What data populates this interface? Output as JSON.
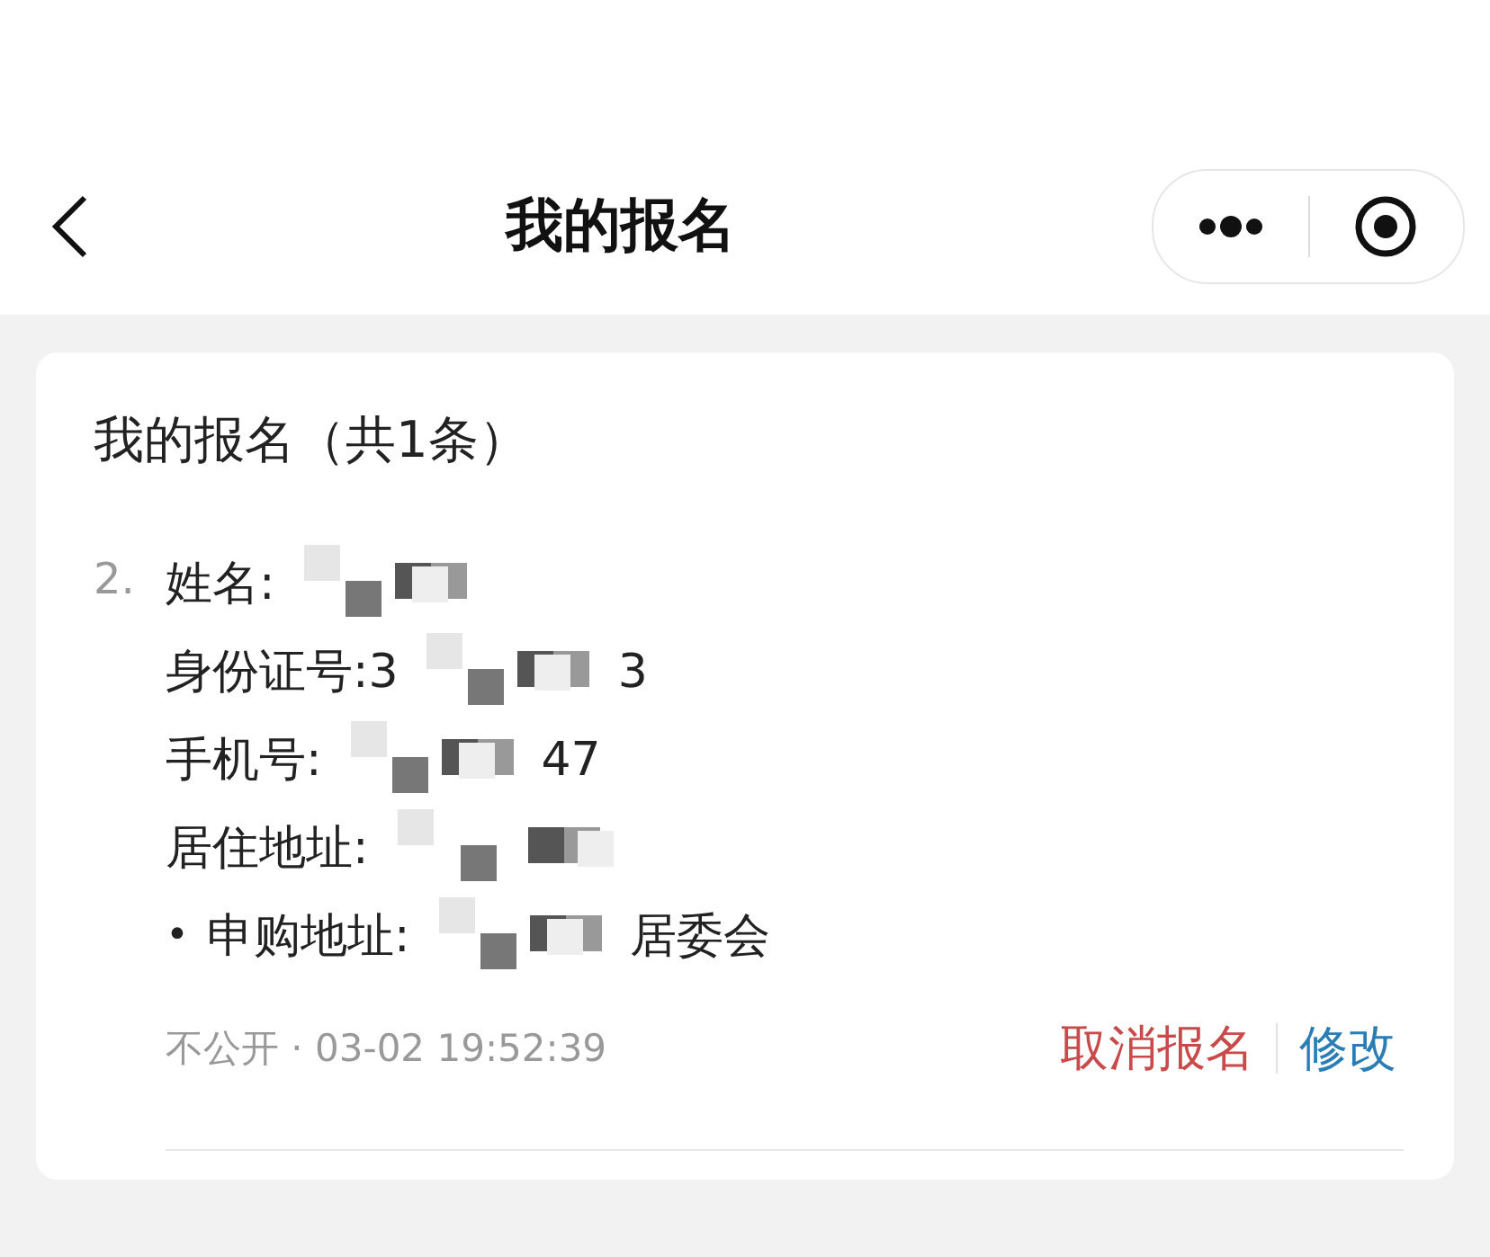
{
  "nav": {
    "title": "我的报名"
  },
  "card": {
    "title": "我的报名（共1条）",
    "entry": {
      "number": "2.",
      "fields": [
        {
          "kind": "plain",
          "label": "姓名:",
          "segments": [
            {
              "kind": "mask"
            }
          ]
        },
        {
          "kind": "plain",
          "label": "身份证号:",
          "segments": [
            {
              "kind": "text",
              "text": "3"
            },
            {
              "kind": "mask"
            },
            {
              "kind": "text",
              "text": "3"
            }
          ]
        },
        {
          "kind": "plain",
          "label": "手机号:",
          "segments": [
            {
              "kind": "mask"
            },
            {
              "kind": "text",
              "text": "47"
            }
          ]
        },
        {
          "kind": "plain",
          "label": "居住地址:",
          "segments": [
            {
              "kind": "mask"
            }
          ]
        },
        {
          "kind": "bullet",
          "bullet": "•",
          "label": "申购地址:",
          "segments": [
            {
              "kind": "mask"
            },
            {
              "kind": "text",
              "text": "居委会"
            }
          ]
        }
      ],
      "meta": "不公开 · 03-02 19:52:39",
      "actions": [
        {
          "kind": "danger",
          "label": "取消报名"
        },
        {
          "kind": "link",
          "label": "修改"
        }
      ]
    }
  }
}
